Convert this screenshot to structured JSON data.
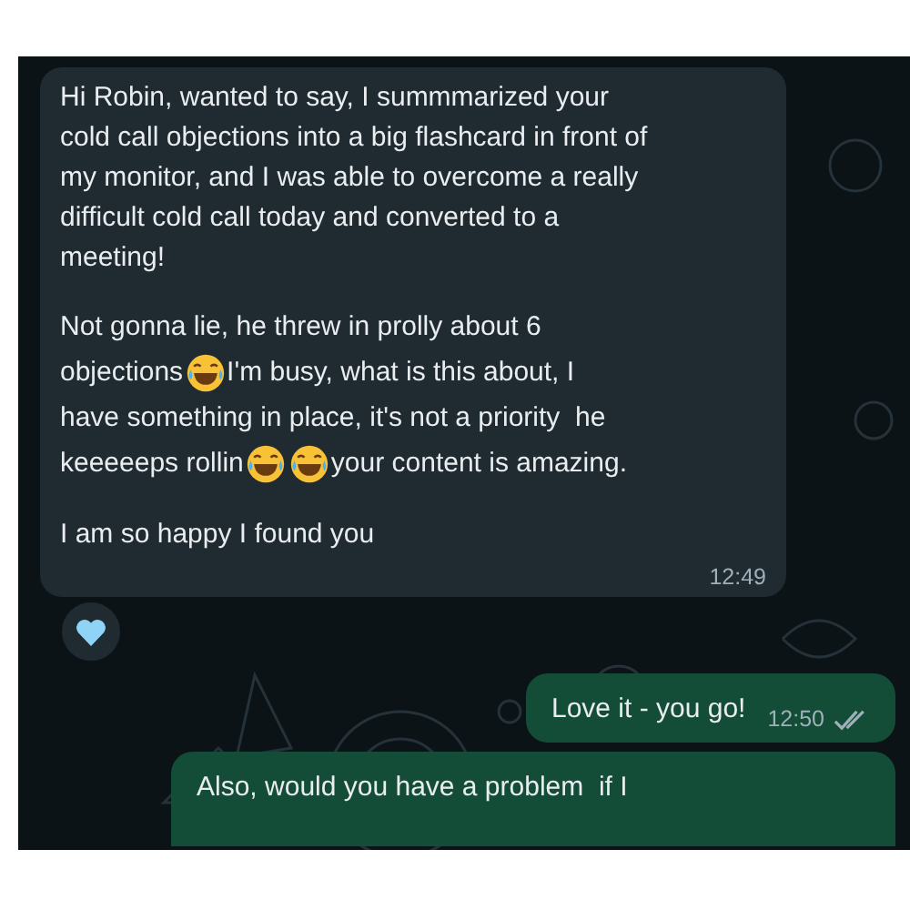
{
  "messages": [
    {
      "kind": "incoming",
      "time": "12:49",
      "reaction": {
        "kind": "heart"
      },
      "paragraphs": [
        {
          "lines": [
            [
              {
                "kind": "text",
                "text": "Hi Robin, wanted to say, I summmarized your cold call objections into a big flashcard in front of my monitor, and I was able to overcome a really difficult cold call today and converted to a meeting!"
              }
            ]
          ]
        },
        {
          "lines": [
            [
              {
                "kind": "text",
                "text": "Not gonna lie, he threw in prolly about 6"
              }
            ],
            [
              {
                "kind": "text",
                "text": "objections"
              },
              {
                "kind": "emoji"
              },
              {
                "kind": "text",
                "text": "I'm busy, what is this about, I"
              }
            ],
            [
              {
                "kind": "text",
                "text": "have something in place, it's not a priority  he"
              }
            ],
            [
              {
                "kind": "text",
                "text": "keeeeeps rollin"
              },
              {
                "kind": "emoji"
              },
              {
                "kind": "emoji"
              },
              {
                "kind": "text",
                "text": "your content is amazing."
              }
            ]
          ]
        },
        {
          "lines": [
            [
              {
                "kind": "text",
                "text": "I am so happy I found you"
              }
            ]
          ]
        }
      ]
    },
    {
      "kind": "outgoing",
      "time": "12:50",
      "read": false,
      "paragraphs": [
        {
          "lines": [
            [
              {
                "kind": "text",
                "text": "Love it - you go!"
              }
            ]
          ]
        }
      ]
    },
    {
      "kind": "outgoing",
      "paragraphs": [
        {
          "lines": [
            [
              {
                "kind": "text",
                "text": "Also, would you have a problem  if I"
              }
            ]
          ]
        }
      ]
    }
  ]
}
